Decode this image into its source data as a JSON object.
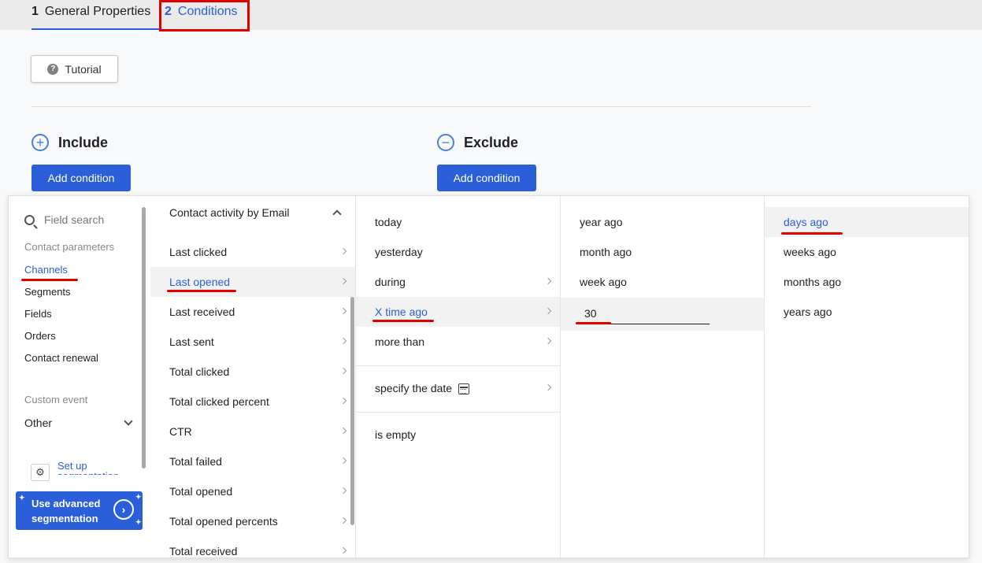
{
  "tabs": [
    {
      "num": "1",
      "label": "General Properties"
    },
    {
      "num": "2",
      "label": "Conditions"
    }
  ],
  "tutorial": {
    "label": "Tutorial",
    "icon": "question-icon"
  },
  "include": {
    "title": "Include",
    "button": "Add condition",
    "icon": "plus-circle-icon"
  },
  "exclude": {
    "title": "Exclude",
    "button": "Add condition",
    "icon": "minus-circle-icon"
  },
  "col1": {
    "search_placeholder": "Field search",
    "contact_params_label": "Contact parameters",
    "items": [
      "Channels",
      "Segments",
      "Fields",
      "Orders",
      "Contact renewal"
    ],
    "custom_event_label": "Custom event",
    "other_label": "Other",
    "setup_label": "Set up segmentation",
    "advanced_label_1": "Use advanced",
    "advanced_label_2": "segmentation"
  },
  "col2": {
    "header": "Contact activity by Email",
    "items": [
      "Last clicked",
      "Last opened",
      "Last received",
      "Last sent",
      "Total clicked",
      "Total clicked percent",
      "CTR",
      "Total failed",
      "Total opened",
      "Total opened percents",
      "Total received"
    ]
  },
  "col3": {
    "items": [
      "today",
      "yesterday",
      "during",
      "X time ago",
      "more than"
    ],
    "specify": "specify the date",
    "empty": "is empty"
  },
  "col4": {
    "items": [
      "year ago",
      "month ago",
      "week ago"
    ],
    "input_value": "30"
  },
  "col5": {
    "items": [
      "days ago",
      "weeks ago",
      "months ago",
      "years ago"
    ]
  },
  "colors": {
    "accent": "#2b5fd9",
    "highlight": "#e00000"
  }
}
